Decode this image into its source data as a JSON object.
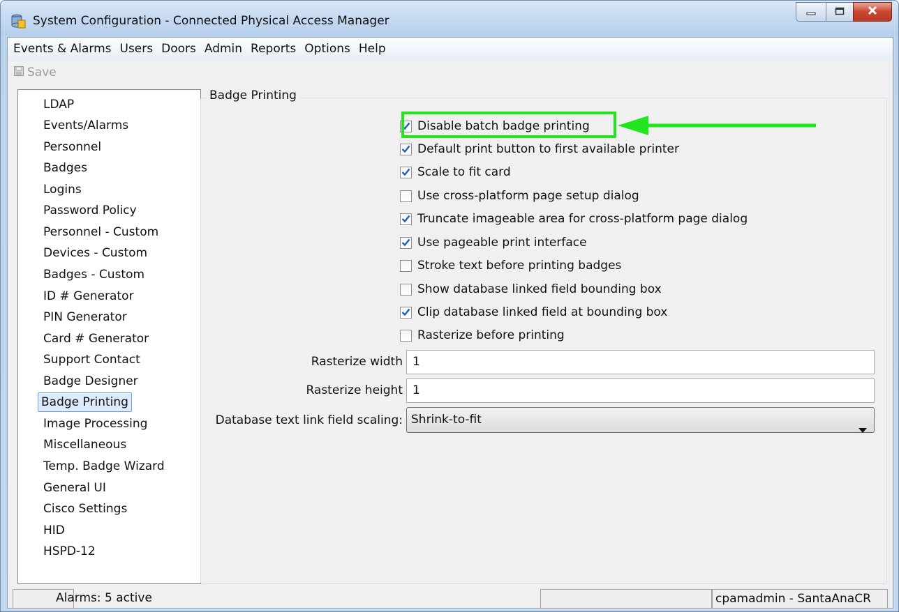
{
  "window": {
    "title": "System Configuration - Connected Physical Access Manager"
  },
  "menu": [
    "Events & Alarms",
    "Users",
    "Doors",
    "Admin",
    "Reports",
    "Options",
    "Help"
  ],
  "toolbar": {
    "save_label": "Save"
  },
  "sidebar": {
    "items": [
      {
        "label": "LDAP"
      },
      {
        "label": "Events/Alarms"
      },
      {
        "label": "Personnel"
      },
      {
        "label": "Badges"
      },
      {
        "label": "Logins"
      },
      {
        "label": "Password Policy"
      },
      {
        "label": "Personnel - Custom"
      },
      {
        "label": "Devices - Custom"
      },
      {
        "label": "Badges - Custom"
      },
      {
        "label": "ID # Generator"
      },
      {
        "label": "PIN Generator"
      },
      {
        "label": "Card # Generator"
      },
      {
        "label": "Support Contact"
      },
      {
        "label": "Badge Designer"
      },
      {
        "label": "Badge Printing",
        "selected": true
      },
      {
        "label": "Image Processing"
      },
      {
        "label": "Miscellaneous"
      },
      {
        "label": "Temp. Badge Wizard"
      },
      {
        "label": "General UI"
      },
      {
        "label": "Cisco Settings"
      },
      {
        "label": "HID"
      },
      {
        "label": "HSPD-12"
      }
    ]
  },
  "panel": {
    "title": "Badge Printing",
    "checkboxes": [
      {
        "label": "Disable batch badge printing",
        "checked": true
      },
      {
        "label": "Default print button to first available printer",
        "checked": true
      },
      {
        "label": "Scale to fit card",
        "checked": true
      },
      {
        "label": "Use cross-platform page setup dialog",
        "checked": false
      },
      {
        "label": "Truncate imageable area for cross-platform page dialog",
        "checked": true
      },
      {
        "label": "Use pageable print interface",
        "checked": true
      },
      {
        "label": "Stroke text before printing badges",
        "checked": false
      },
      {
        "label": "Show database linked field bounding box",
        "checked": false
      },
      {
        "label": "Clip database linked field at bounding box",
        "checked": true
      },
      {
        "label": "Rasterize before printing",
        "checked": false
      }
    ],
    "rasterize_width": {
      "label": "Rasterize width",
      "value": "1"
    },
    "rasterize_height": {
      "label": "Rasterize height",
      "value": "1"
    },
    "scaling": {
      "label": "Database text link field scaling:",
      "value": "Shrink-to-fit"
    }
  },
  "status": {
    "alarms": "Alarms: 5 active",
    "middle": "",
    "user": "cpamadmin - SantaAnaCR"
  },
  "colors": {
    "highlight": "#22e41f",
    "check": "#1d5fb8"
  },
  "icons": [
    "app-icon",
    "minimize-icon",
    "maximize-icon",
    "close-icon",
    "save-icon",
    "checkbox-check-icon",
    "dropdown-arrow-icon",
    "annotation-arrow"
  ]
}
